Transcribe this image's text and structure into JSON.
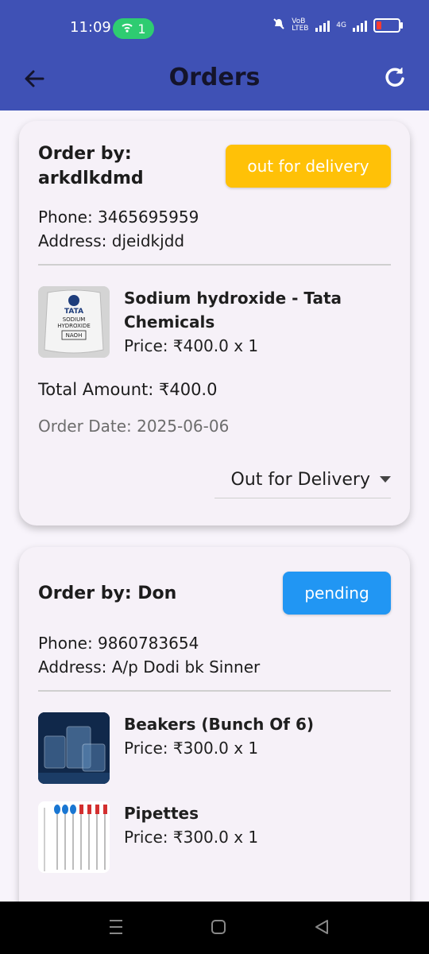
{
  "status_bar": {
    "time": "11:09",
    "hotspot_count": "1",
    "network1": "VoB LTEB",
    "network2": "4G"
  },
  "app_bar": {
    "title": "Orders"
  },
  "orders": [
    {
      "order_by": "Order by: arkdlkdmd",
      "status_badge": "out for delivery",
      "status_badge_color": "#ffc107",
      "phone": "Phone: 3465695959",
      "address": "Address: djeidkjdd",
      "items": [
        {
          "name": "Sodium hydroxide - Tata Chemicals",
          "price": "Price: ₹400.0 x 1",
          "thumb_brand": "TATA",
          "thumb_text1": "SODIUM",
          "thumb_text2": "HYDROXIDE",
          "thumb_text3": "NAOH"
        }
      ],
      "total": "Total Amount: ₹400.0",
      "order_date": "Order Date: 2025-06-06",
      "dropdown_value": "Out for Delivery"
    },
    {
      "order_by": "Order by: Don",
      "status_badge": "pending",
      "status_badge_color": "#2196f3",
      "phone": "Phone: 9860783654",
      "address": "Address: A/p Dodi bk Sinner",
      "items": [
        {
          "name": "Beakers (Bunch Of 6)",
          "price": "Price: ₹300.0 x 1"
        },
        {
          "name": "Pipettes",
          "price": "Price: ₹300.0 x 1"
        }
      ]
    }
  ],
  "colors": {
    "app_bar": "#3f51b5",
    "background": "#f8f4fb"
  }
}
